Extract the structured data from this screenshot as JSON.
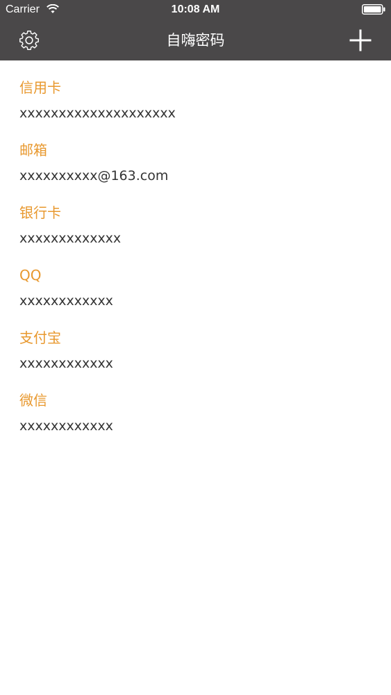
{
  "status_bar": {
    "carrier": "Carrier",
    "time": "10:08 AM"
  },
  "navbar": {
    "title": "自嗨密码",
    "left_icon": "gear-icon",
    "right_icon": "plus-icon"
  },
  "colors": {
    "bar_background": "#4a4849",
    "accent": "#e8982e",
    "value_text": "#333333",
    "page_background": "#ffffff"
  },
  "items": [
    {
      "title": "信用卡",
      "value": "xxxxxxxxxxxxxxxxxxxx"
    },
    {
      "title": "邮箱",
      "value": "xxxxxxxxxx@163.com"
    },
    {
      "title": "银行卡",
      "value": "xxxxxxxxxxxxx"
    },
    {
      "title": "QQ",
      "value": "xxxxxxxxxxxx"
    },
    {
      "title": "支付宝",
      "value": "xxxxxxxxxxxx"
    },
    {
      "title": "微信",
      "value": "xxxxxxxxxxxx"
    }
  ]
}
